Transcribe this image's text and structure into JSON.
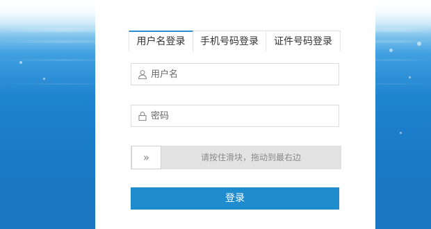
{
  "tabs": [
    {
      "label": "用户名登录",
      "active": true
    },
    {
      "label": "手机号码登录",
      "active": false
    },
    {
      "label": "证件号码登录",
      "active": false
    }
  ],
  "username": {
    "placeholder": "用户名",
    "value": "",
    "icon": "user-icon"
  },
  "password": {
    "placeholder": "密码",
    "value": "",
    "icon": "lock-icon"
  },
  "slider": {
    "handle_glyph": "»",
    "hint": "请按住滑块，拖动到最右边",
    "progress": 0
  },
  "login_button": {
    "label": "登录"
  },
  "colors": {
    "accent": "#1e8ccd",
    "tab_active_border": "#2a8ed0",
    "slider_bg": "#e3e3e3"
  }
}
